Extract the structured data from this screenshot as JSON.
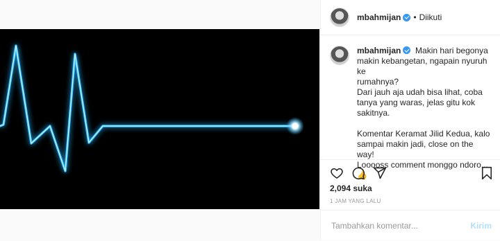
{
  "post": {
    "username": "mbahmijan",
    "follow_status": "Diikuti",
    "caption_lines": [
      "Makin hari begonya",
      "makin kebangetan, ngapain nyuruh ke",
      "rumahnya?",
      "Dari jauh aja udah bisa lihat, coba",
      "tanya yang waras, jelas gitu kok",
      "sakitnya.",
      "Komentar Keramat Jilid Kedua, kalo",
      "sampai makin jadi, close on the way!",
      "Looooss comment monggo ndoro...",
      "👍"
    ],
    "likes": "2,094 suka",
    "timestamp": "1 JAM YANG LALU"
  },
  "comment_box": {
    "placeholder": "Tambahkan komentar...",
    "send_label": "Kirim"
  },
  "icons": {
    "like": "heart-icon",
    "comment": "comment-icon",
    "share": "share-icon",
    "save": "bookmark-icon"
  },
  "colors": {
    "verified": "#3897f0",
    "heartbeat_line": "#28b7ff",
    "send_disabled": "#b2dffc"
  }
}
